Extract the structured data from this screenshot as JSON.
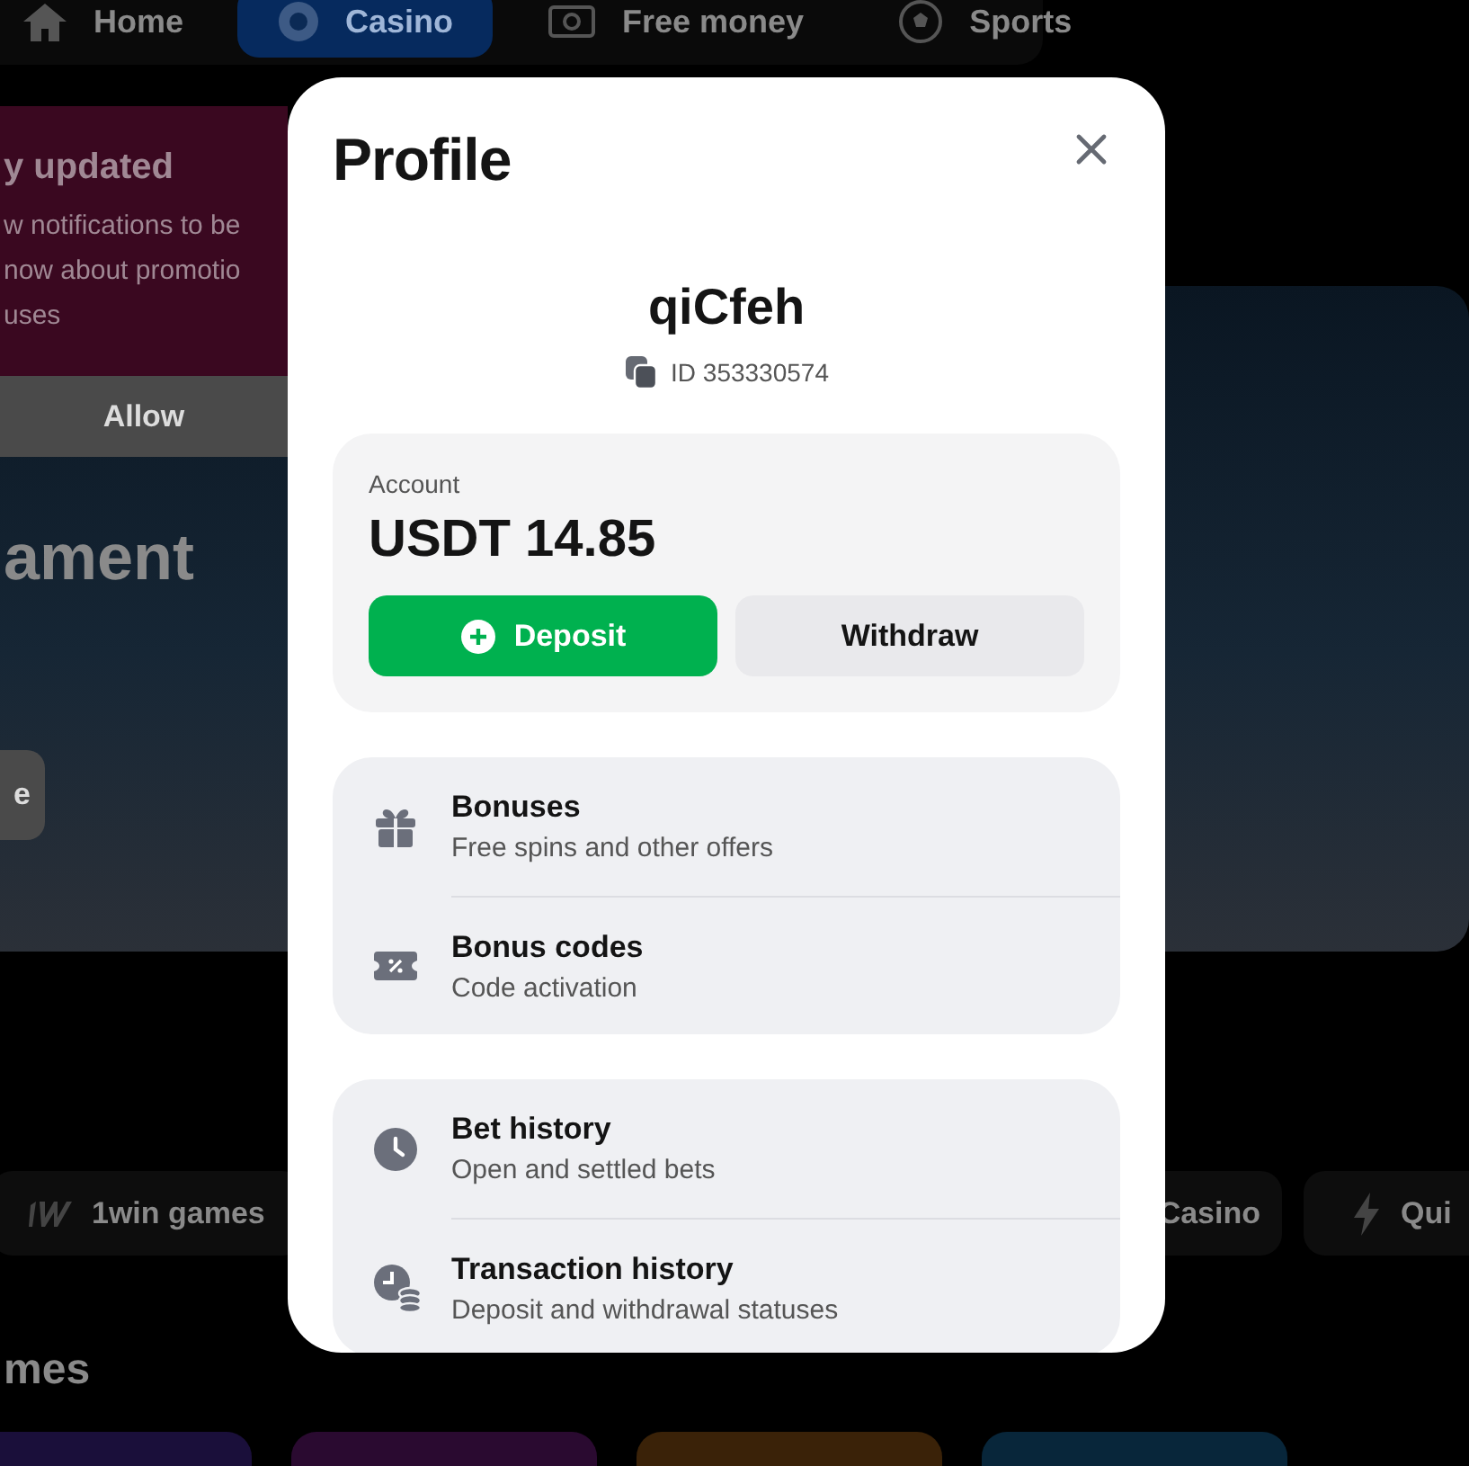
{
  "nav": {
    "tabs": [
      {
        "label": "Home",
        "kind": "home",
        "selected": false
      },
      {
        "label": "Casino",
        "kind": "casino",
        "selected": true
      },
      {
        "label": "Free money",
        "kind": "money",
        "selected": false
      },
      {
        "label": "Sports",
        "kind": "ball",
        "selected": false
      }
    ]
  },
  "notification": {
    "title": "y updated",
    "lines": [
      "w notifications to be",
      "now about promotio",
      "uses"
    ],
    "button": "Allow"
  },
  "hero": {
    "title": "ament",
    "button": "e"
  },
  "categories": [
    {
      "label": "1win games",
      "kind": "logo"
    },
    {
      "label": "Casino",
      "kind": "plain"
    },
    {
      "label": "Qui",
      "kind": "bolt"
    }
  ],
  "section_title": "mes",
  "profile": {
    "title": "Profile",
    "username": "qiCfeh",
    "user_id": "ID 353330574",
    "account": {
      "label": "Account",
      "balance": "USDT 14.85",
      "deposit": "Deposit",
      "withdraw": "Withdraw"
    },
    "groups": [
      [
        {
          "title": "Bonuses",
          "subtitle": "Free spins and other offers",
          "kind": "gift"
        },
        {
          "title": "Bonus codes",
          "subtitle": "Code activation",
          "kind": "ticket"
        }
      ],
      [
        {
          "title": "Bet history",
          "subtitle": "Open and settled bets",
          "kind": "clock"
        },
        {
          "title": "Transaction history",
          "subtitle": "Deposit and withdrawal statuses",
          "kind": "clockcoins"
        }
      ]
    ]
  }
}
